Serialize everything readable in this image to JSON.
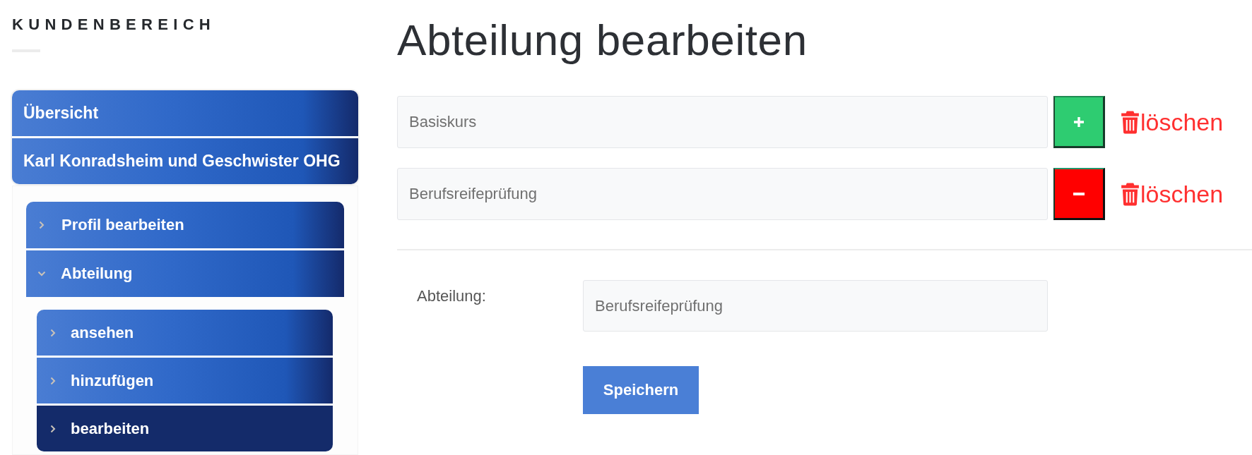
{
  "sidebar": {
    "title": "KUNDENBEREICH",
    "items": [
      {
        "label": "Übersicht",
        "selected": false
      },
      {
        "label": "Karl Konradsheim und Geschwister OHG",
        "selected": false,
        "children": [
          {
            "label": "Profil bearbeiten",
            "selected": false,
            "expanded": false
          },
          {
            "label": "Abteilung",
            "selected": false,
            "expanded": true,
            "children": [
              {
                "label": "ansehen",
                "selected": false
              },
              {
                "label": "hinzufügen",
                "selected": false
              },
              {
                "label": "bearbeiten",
                "selected": true
              }
            ]
          }
        ]
      }
    ]
  },
  "main": {
    "title": "Abteilung bearbeiten",
    "departments": [
      {
        "value": "Basiskurs",
        "kind": "add",
        "delete_label": "löschen"
      },
      {
        "value": "Berufsreifeprüfung",
        "kind": "remove",
        "delete_label": "löschen"
      }
    ],
    "form": {
      "label": "Abteilung:",
      "value": "Berufsreifeprüfung",
      "submit": "Speichern"
    }
  }
}
